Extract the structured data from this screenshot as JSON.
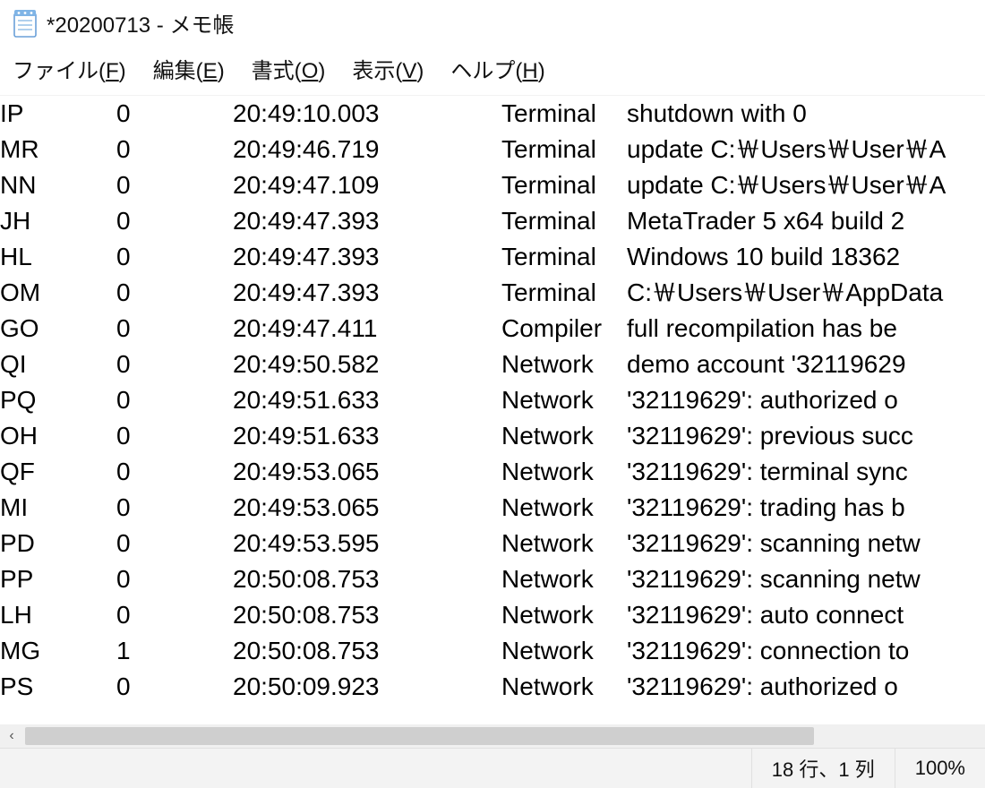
{
  "title": "*20200713 - メモ帳",
  "menu": {
    "file": "ファイル(F)",
    "edit": "編集(E)",
    "format": "書式(O)",
    "view": "表示(V)",
    "help": "ヘルプ(H)"
  },
  "status": {
    "pos": "18 行、1 列",
    "zoom": "100%"
  },
  "rows": [
    {
      "c0": "IP",
      "c1": "0",
      "c2": "20:49:10.003",
      "c3": "Terminal",
      "c4": "shutdown with 0"
    },
    {
      "c0": "MR",
      "c1": "0",
      "c2": "20:49:46.719",
      "c3": "Terminal",
      "c4": "update C:\\Users\\User\\A"
    },
    {
      "c0": "NN",
      "c1": "0",
      "c2": "20:49:47.109",
      "c3": "Terminal",
      "c4": "update C:\\Users\\User\\A"
    },
    {
      "c0": "JH",
      "c1": "0",
      "c2": "20:49:47.393",
      "c3": "Terminal",
      "c4": "MetaTrader 5 x64 build 2"
    },
    {
      "c0": "HL",
      "c1": "0",
      "c2": "20:49:47.393",
      "c3": "Terminal",
      "c4": "Windows 10 build 18362"
    },
    {
      "c0": "OM",
      "c1": "0",
      "c2": "20:49:47.393",
      "c3": "Terminal",
      "c4": "C:\\Users\\User\\AppData"
    },
    {
      "c0": "GO",
      "c1": "0",
      "c2": "20:49:47.411",
      "c3": "Compiler",
      "c4": "full recompilation has be"
    },
    {
      "c0": "QI",
      "c1": "0",
      "c2": "20:49:50.582",
      "c3": "Network",
      "c4": "demo account '32119629"
    },
    {
      "c0": "PQ",
      "c1": "0",
      "c2": "20:49:51.633",
      "c3": "Network",
      "c4": "'32119629': authorized o"
    },
    {
      "c0": "OH",
      "c1": "0",
      "c2": "20:49:51.633",
      "c3": "Network",
      "c4": "'32119629': previous succ"
    },
    {
      "c0": "QF",
      "c1": "0",
      "c2": "20:49:53.065",
      "c3": "Network",
      "c4": "'32119629': terminal sync"
    },
    {
      "c0": "MI",
      "c1": "0",
      "c2": "20:49:53.065",
      "c3": "Network",
      "c4": "'32119629': trading has b"
    },
    {
      "c0": "PD",
      "c1": "0",
      "c2": "20:49:53.595",
      "c3": "Network",
      "c4": "'32119629': scanning netw"
    },
    {
      "c0": "PP",
      "c1": "0",
      "c2": "20:50:08.753",
      "c3": "Network",
      "c4": "'32119629': scanning netw"
    },
    {
      "c0": "LH",
      "c1": "0",
      "c2": "20:50:08.753",
      "c3": "Network",
      "c4": "'32119629': auto connect"
    },
    {
      "c0": "MG",
      "c1": "1",
      "c2": "20:50:08.753",
      "c3": "Network",
      "c4": "'32119629': connection to"
    },
    {
      "c0": "PS",
      "c1": "0",
      "c2": "20:50:09.923",
      "c3": "Network",
      "c4": "'32119629': authorized o"
    }
  ],
  "cols": {
    "c0": 0,
    "c1": 130,
    "c2": 260,
    "c3": 560,
    "c4": 700
  },
  "won": "￦"
}
